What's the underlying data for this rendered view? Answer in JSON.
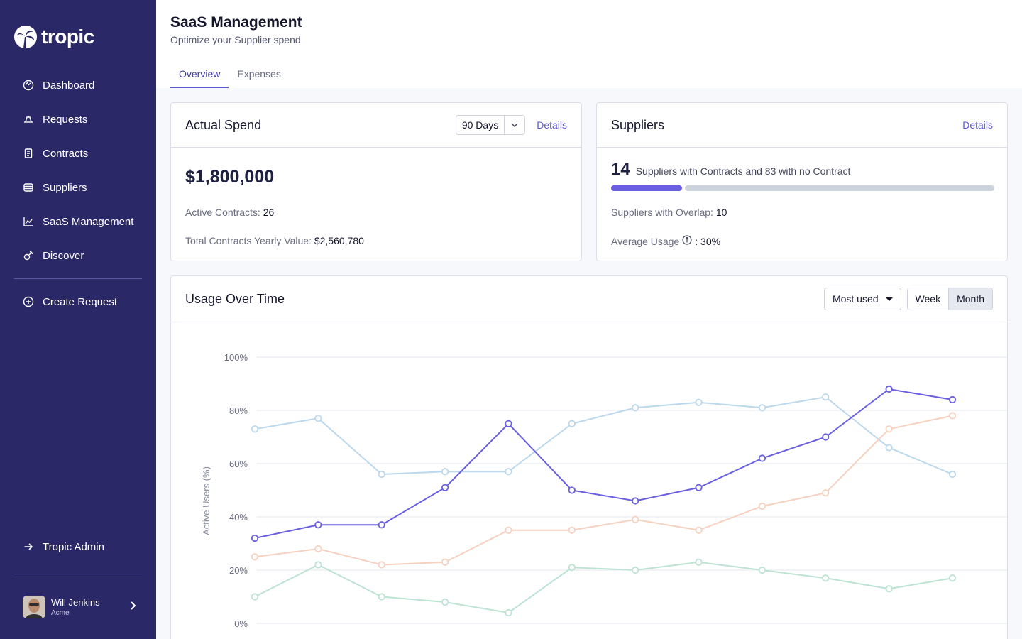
{
  "brand": {
    "name": "tropic"
  },
  "sidebar": {
    "items": [
      {
        "label": "Dashboard",
        "icon": "dashboard-icon"
      },
      {
        "label": "Requests",
        "icon": "requests-icon"
      },
      {
        "label": "Contracts",
        "icon": "contracts-icon"
      },
      {
        "label": "Suppliers",
        "icon": "suppliers-icon"
      },
      {
        "label": "SaaS Management",
        "icon": "chart-line-icon"
      },
      {
        "label": "Discover",
        "icon": "discover-icon"
      }
    ],
    "create_request": "Create Request",
    "admin": "Tropic Admin",
    "user": {
      "name": "Will Jenkins",
      "org": "Acme"
    }
  },
  "header": {
    "title": "SaaS Management",
    "subtitle": "Optimize your Supplier spend",
    "tabs": [
      {
        "label": "Overview",
        "active": true
      },
      {
        "label": "Expenses",
        "active": false
      }
    ]
  },
  "spend": {
    "title": "Actual Spend",
    "range": "90 Days",
    "details": "Details",
    "amount": "$1,800,000",
    "active_contracts_label": "Active Contracts:",
    "active_contracts_value": "26",
    "yearly_value_label": "Total Contracts Yearly Value:",
    "yearly_value": "$2,560,780"
  },
  "suppliers": {
    "title": "Suppliers",
    "details": "Details",
    "count": "14",
    "text": "Suppliers with Contracts and 83 with no Contract",
    "contract_fraction": 0.1443,
    "overlap_label": "Suppliers with Overlap:",
    "overlap_value": "10",
    "usage_label": "Average Usage",
    "usage_value": ": 30%"
  },
  "usage": {
    "title": "Usage Over Time",
    "filter": "Most used",
    "periods": [
      {
        "label": "Week",
        "active": false
      },
      {
        "label": "Month",
        "active": true
      }
    ]
  },
  "chart_data": {
    "type": "line",
    "ylabel": "Active Users (%)",
    "ylim": [
      0,
      100
    ],
    "yticks": [
      "0%",
      "20%",
      "40%",
      "60%",
      "80%",
      "100%"
    ],
    "ytick_values": [
      0,
      20,
      40,
      60,
      80,
      100
    ],
    "x": [
      1,
      2,
      3,
      4,
      5,
      6,
      7,
      8,
      9,
      10,
      11,
      12
    ],
    "grid": true,
    "series": [
      {
        "color": "#bcd8ec",
        "values": [
          73,
          77,
          56,
          57,
          57,
          75,
          81,
          83,
          81,
          85,
          66,
          56
        ]
      },
      {
        "color": "#f6d1c0",
        "values": [
          25,
          28,
          22,
          23,
          35,
          35,
          39,
          35,
          44,
          49,
          73,
          78
        ]
      },
      {
        "color": "#bde3d3",
        "values": [
          10,
          22,
          10,
          8,
          4,
          21,
          20,
          23,
          20,
          17,
          13,
          17
        ]
      },
      {
        "color": "#6a5fe0",
        "values": [
          32,
          37,
          37,
          51,
          75,
          50,
          46,
          51,
          62,
          70,
          88,
          84
        ]
      }
    ]
  }
}
